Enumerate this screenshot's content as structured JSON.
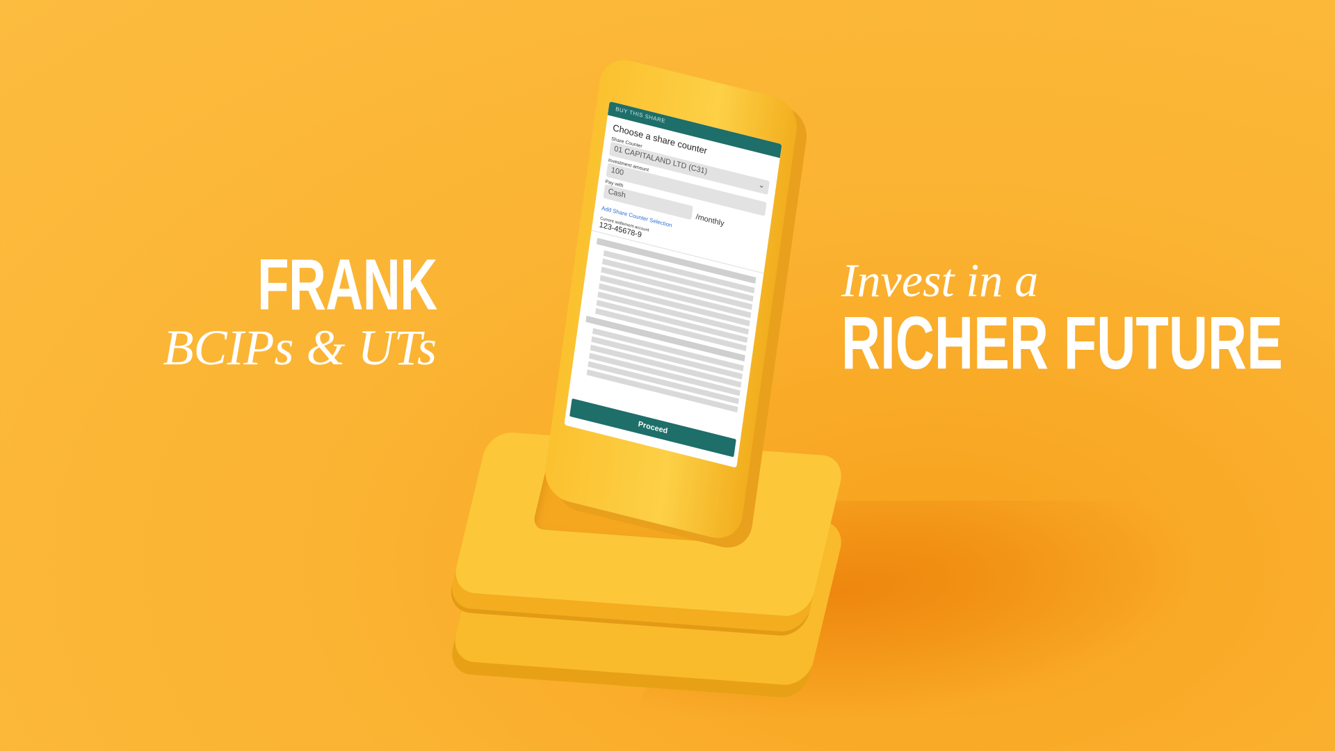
{
  "left_heading": {
    "brand": "FRANK",
    "sub": "BCIPs & UTs"
  },
  "right_heading": {
    "line1": "Invest in a",
    "line2": "RICHER FUTURE"
  },
  "app": {
    "header": "BUY THIS SHARE",
    "title": "Choose a share counter",
    "share_counter": {
      "label": "Share Counter",
      "value": "01 CAPITALAND LTD (C31)"
    },
    "investment_amount": {
      "label": "Investment amount",
      "value": "100"
    },
    "pay_with": {
      "label": "Pay with",
      "value": "Cash",
      "suffix": "/monthly"
    },
    "add_link": "Add  Share Counter Selection",
    "account": {
      "label": "Current settlement account",
      "value": "123-45678-9"
    },
    "proceed_label": "Proceed"
  },
  "colors": {
    "background": "#fbb332",
    "accent": "#1e6e69",
    "link": "#2f6fd1"
  }
}
